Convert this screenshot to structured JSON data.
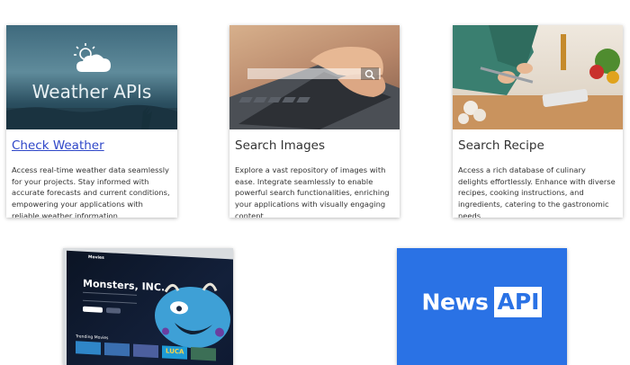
{
  "cards": [
    {
      "title": "Check Weather",
      "thumb_text": "Weather APIs",
      "description": "Access real-time weather data seamlessly for your projects. Stay informed with accurate forecasts and current conditions, empowering your applications with reliable weather information.",
      "thumb_icon": "cloud-sun-icon"
    },
    {
      "title": "Search Images",
      "description": "Explore a vast repository of images with ease. Integrate seamlessly to enable powerful search functionalities, enriching your applications with visually engaging content.",
      "thumb_icon": "search-icon"
    },
    {
      "title": "Search Recipe",
      "description": "Access a rich database of culinary delights effortlessly. Enhance with diverse recipes, cooking instructions, and ingredients, catering to the gastronomic needs."
    },
    {
      "thumb_brand": "Movies",
      "thumb_title": "Monsters, INC.",
      "thumb_section": "Trending Movies",
      "thumb_tile_text": "LUCA"
    },
    {
      "thumb_logo_left": "News",
      "thumb_logo_right": "API"
    }
  ],
  "colors": {
    "link": "#2f47c8",
    "news_blue": "#2a72e5"
  }
}
